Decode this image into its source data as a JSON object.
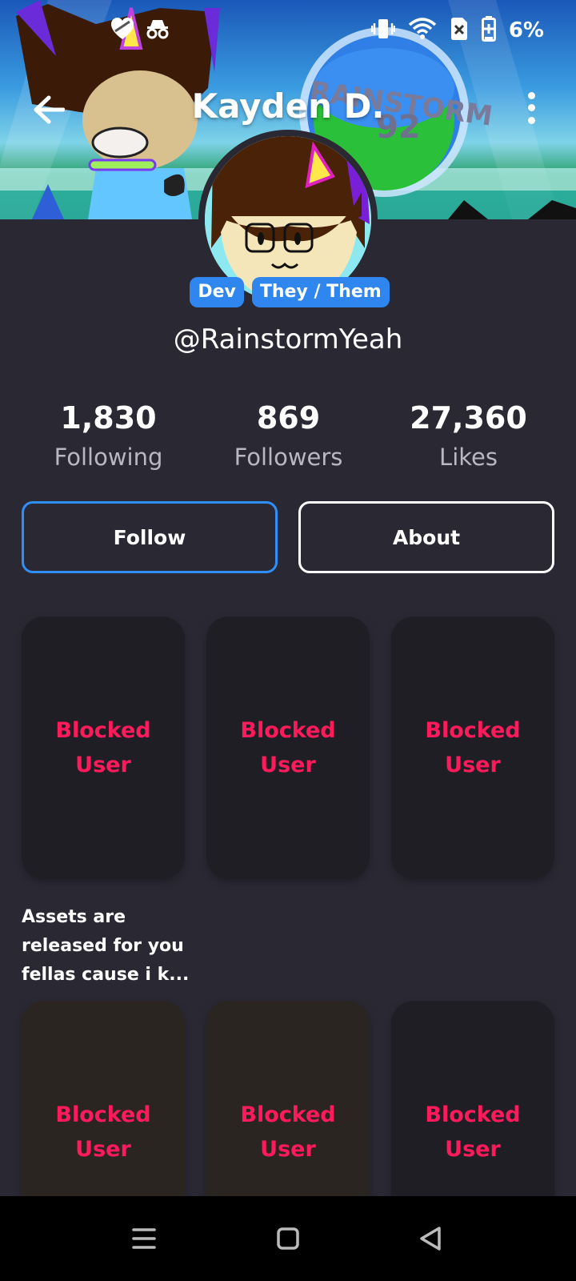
{
  "status_bar": {
    "battery_percent": "6%",
    "icons": [
      "heart-shield-icon",
      "incognito-icon",
      "vibrate-icon",
      "wifi-icon",
      "sim-off-icon",
      "battery-icon"
    ]
  },
  "header": {
    "title": "Kayden D.",
    "back_icon": "arrow-left-icon",
    "menu_icon": "more-vertical-icon"
  },
  "profile": {
    "badges": [
      "Dev",
      "They / Them"
    ],
    "handle": "@RainstormYeah",
    "stats": [
      {
        "value": "1,830",
        "label": "Following"
      },
      {
        "value": "869",
        "label": "Followers"
      },
      {
        "value": "27,360",
        "label": "Likes"
      }
    ]
  },
  "actions": {
    "follow_label": "Follow",
    "about_label": "About"
  },
  "posts": [
    {
      "label_line1": "Blocked",
      "label_line2": "User",
      "caption": "Assets are released for you fellas cause i k..."
    },
    {
      "label_line1": "Blocked",
      "label_line2": "User",
      "caption": ""
    },
    {
      "label_line1": "Blocked",
      "label_line2": "User",
      "caption": ""
    },
    {
      "label_line1": "Blocked",
      "label_line2": "User",
      "caption": ""
    },
    {
      "label_line1": "Blocked",
      "label_line2": "User",
      "caption": ""
    },
    {
      "label_line1": "Blocked",
      "label_line2": "User",
      "caption": ""
    }
  ],
  "nav_bar": {
    "icons": [
      "recents-icon",
      "home-icon",
      "back-triangle-icon"
    ]
  },
  "colors": {
    "background": "#2a2833",
    "accent": "#2f86ee",
    "blocked_text": "#ff1a5c"
  }
}
